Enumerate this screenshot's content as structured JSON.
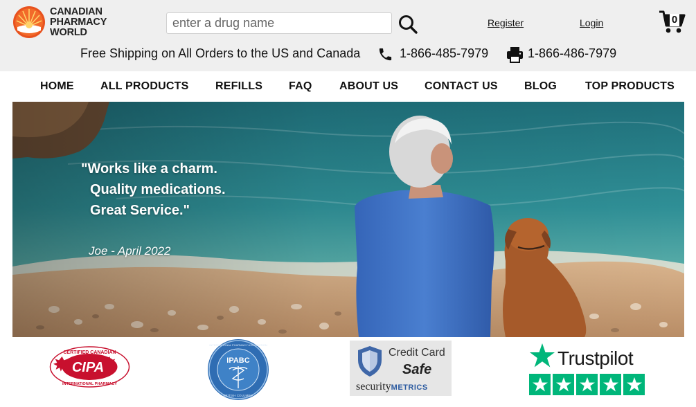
{
  "brand": {
    "line1": "CANADIAN",
    "line2": "PHARMACY",
    "line3": "WORLD",
    "accent_color": "#e8521e"
  },
  "search": {
    "placeholder": "enter a drug name",
    "icon": "search-icon"
  },
  "account": {
    "register": "Register",
    "login": "Login"
  },
  "cart": {
    "count": "0",
    "icon": "cart-icon"
  },
  "contact": {
    "shipping": "Free Shipping on All Orders to the US and Canada",
    "phone": "1-866-485-7979",
    "fax": "1-866-486-7979",
    "phone_icon": "phone-icon",
    "fax_icon": "fax-icon"
  },
  "nav": [
    {
      "label": "HOME"
    },
    {
      "label": "ALL PRODUCTS"
    },
    {
      "label": "REFILLS"
    },
    {
      "label": "FAQ"
    },
    {
      "label": "ABOUT US"
    },
    {
      "label": "CONTACT US"
    },
    {
      "label": "BLOG"
    },
    {
      "label": "TOP PRODUCTS"
    }
  ],
  "hero": {
    "quote_line1": "\"Works like a charm.",
    "quote_line2": "Quality medications.",
    "quote_line3": "Great Service.\"",
    "author": "Joe - April 2022"
  },
  "badges": {
    "cipa_top": "CERTIFIED CANADIAN",
    "cipa_logo": "CIPA",
    "cipa_bottom": "INTERNATIONAL PHARMACY",
    "ipabc": "IPABC",
    "ipabc_ring_top": "INTERNATIONAL PHARMACY ASSOCIATION",
    "ipabc_ring_bottom": "BRITISH COLUMBIA",
    "secm_line1": "Credit Card",
    "secm_line2": "Safe",
    "secm_word1": "security",
    "secm_word2": "METRICS",
    "trustpilot": "Trustpilot",
    "trustpilot_color": "#00b67a"
  }
}
